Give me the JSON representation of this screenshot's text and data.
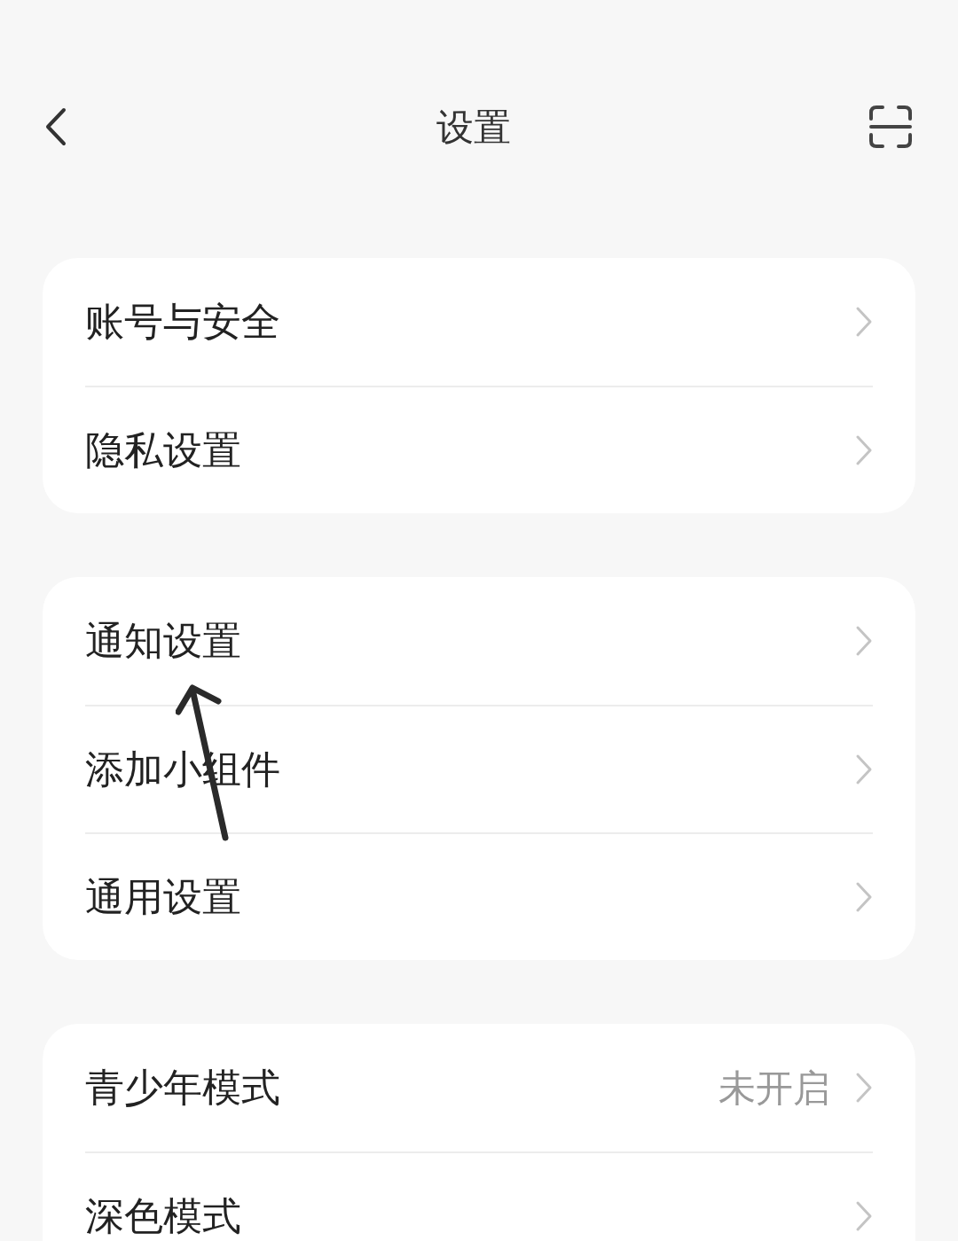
{
  "header": {
    "title": "设置"
  },
  "groups": [
    {
      "items": [
        {
          "label": "账号与安全"
        },
        {
          "label": "隐私设置"
        }
      ]
    },
    {
      "items": [
        {
          "label": "通知设置"
        },
        {
          "label": "添加小组件"
        },
        {
          "label": "通用设置"
        }
      ]
    },
    {
      "items": [
        {
          "label": "青少年模式",
          "value": "未开启"
        },
        {
          "label": "深色模式"
        }
      ]
    }
  ]
}
